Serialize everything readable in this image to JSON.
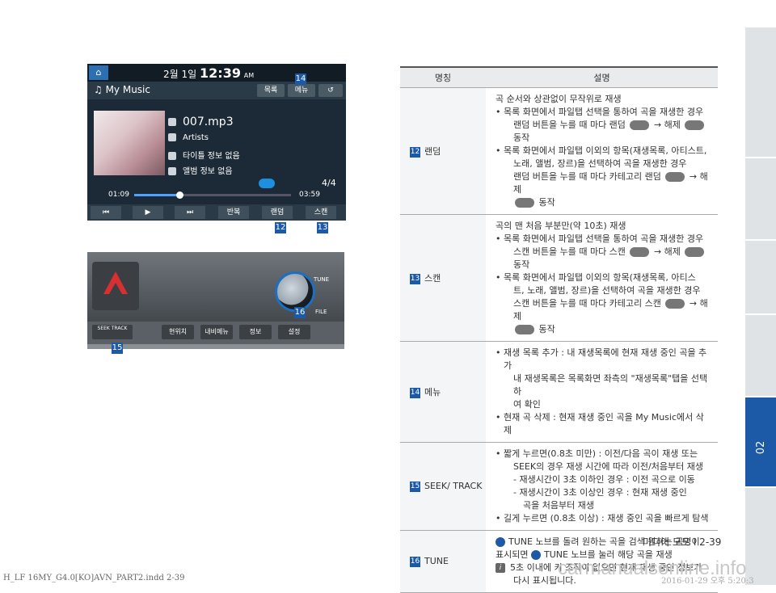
{
  "side_tab": {
    "number": "02"
  },
  "device": {
    "clock": {
      "month": "2월",
      "day": "1일",
      "time": "12:39",
      "ampm": "AM"
    },
    "title": "My Music",
    "top_buttons": [
      "목록",
      "메뉴",
      "↺"
    ],
    "track": {
      "file": "007.mp3",
      "artist": "Artists",
      "title": "타이틀 정보 없음",
      "album": "앨범 정보 없음"
    },
    "page": "4/4",
    "elapsed": "01:09",
    "total": "03:59",
    "progress_fraction": 0.29,
    "bottom_buttons": [
      "⏮",
      "▶",
      "⏭",
      "반복",
      "랜덤",
      "스캔"
    ]
  },
  "dash": {
    "tune_label": "TUNE",
    "file_label": "FILE",
    "seek_label": "SEEK TRACK",
    "buttons": [
      "현위치",
      "내비메뉴",
      "정보",
      "설정"
    ]
  },
  "callouts": [
    "14",
    "12",
    "13",
    "16",
    "15"
  ],
  "table": {
    "header_name": "명칭",
    "header_desc": "설명",
    "rows": [
      {
        "num": "12",
        "name": "랜덤",
        "lines": [
          "곡 순서와 상관없이 무작위로 재생",
          "• 목록 화면에서 파일탭 선택을 통하여 곡을 재생한 경우",
          "랜덤 버튼을 누를 때 마다 랜덤",
          "→ 해제",
          "동작",
          "• 목록 화면에서 파일탭 이외의 항목(재생목록, 아티스트,",
          "노래, 앨범, 장르)을 선택하여 곡을 재생한 경우",
          "랜덤 버튼을 누를 때 마다 카테고리 랜덤",
          "→ 해제",
          "동작"
        ]
      },
      {
        "num": "13",
        "name": "스캔",
        "lines": [
          "곡의 맨 처음 부분만(약 10초) 재생",
          "• 목록 화면에서 파일탭 선택을 통하여 곡을 재생한 경우",
          "스캔 버튼을 누를 때 마다 스캔",
          "→ 해제",
          "동작",
          "• 목록 화면에서 파일탭 이외의 항목(재생목록, 아티스",
          "트, 노래, 앨범, 장르)을 선택하여 곡을 재생한 경우",
          "스캔 버튼을 누를 때 마다 카테고리 스캔",
          "→ 해제",
          "동작"
        ]
      },
      {
        "num": "14",
        "name": "메뉴",
        "lines": [
          "• 재생 목록 추가 : 내 재생목록에 현재 재생 중인 곡을 추가",
          "내 재생목록은 목록화면 좌측의 \"재생목록\"탭을 선택하",
          "여 확인",
          "• 현재 곡 삭제 : 현재 재생 중인 곡을 My Music에서 삭제"
        ]
      },
      {
        "num": "15",
        "name": "SEEK/ TRACK",
        "lines": [
          "• 짧게 누르면(0.8초 미만) : 이전/다음 곡이 재생 또는",
          "SEEK의 경우 재생 시간에 따라 이전/처음부터 재생",
          "- 재생시간이 3초 이하인 경우 : 이전 곡으로 이동",
          "- 재생시간이 3초 이상인 경우 : 현재 재생 중인",
          "곡을 처음부터 재생",
          "• 길게 누르면 (0.8초 이상) : 재생 중인 곡을 빠르게 탐색"
        ]
      },
      {
        "num": "16",
        "name": "TUNE",
        "lines": [
          "TUNE 노브를 돌려 원하는 곡을 검색 원하는 곡명이",
          "표시되면",
          "TUNE 노브를 눌러 해당 곡을 재생",
          "5초 이내에 키 조작이 없으면 현재 재생 중인 정보가",
          "다시 표시됩니다."
        ]
      }
    ]
  },
  "page_number": "미디어 모드 I 2-39",
  "footer_left": "H_LF 16MY_G4.0[KO]AVN_PART2.indd   2-39",
  "footer_right": "2016-01-29   오후 5:20:3",
  "watermark": "carmanualsonline.info"
}
